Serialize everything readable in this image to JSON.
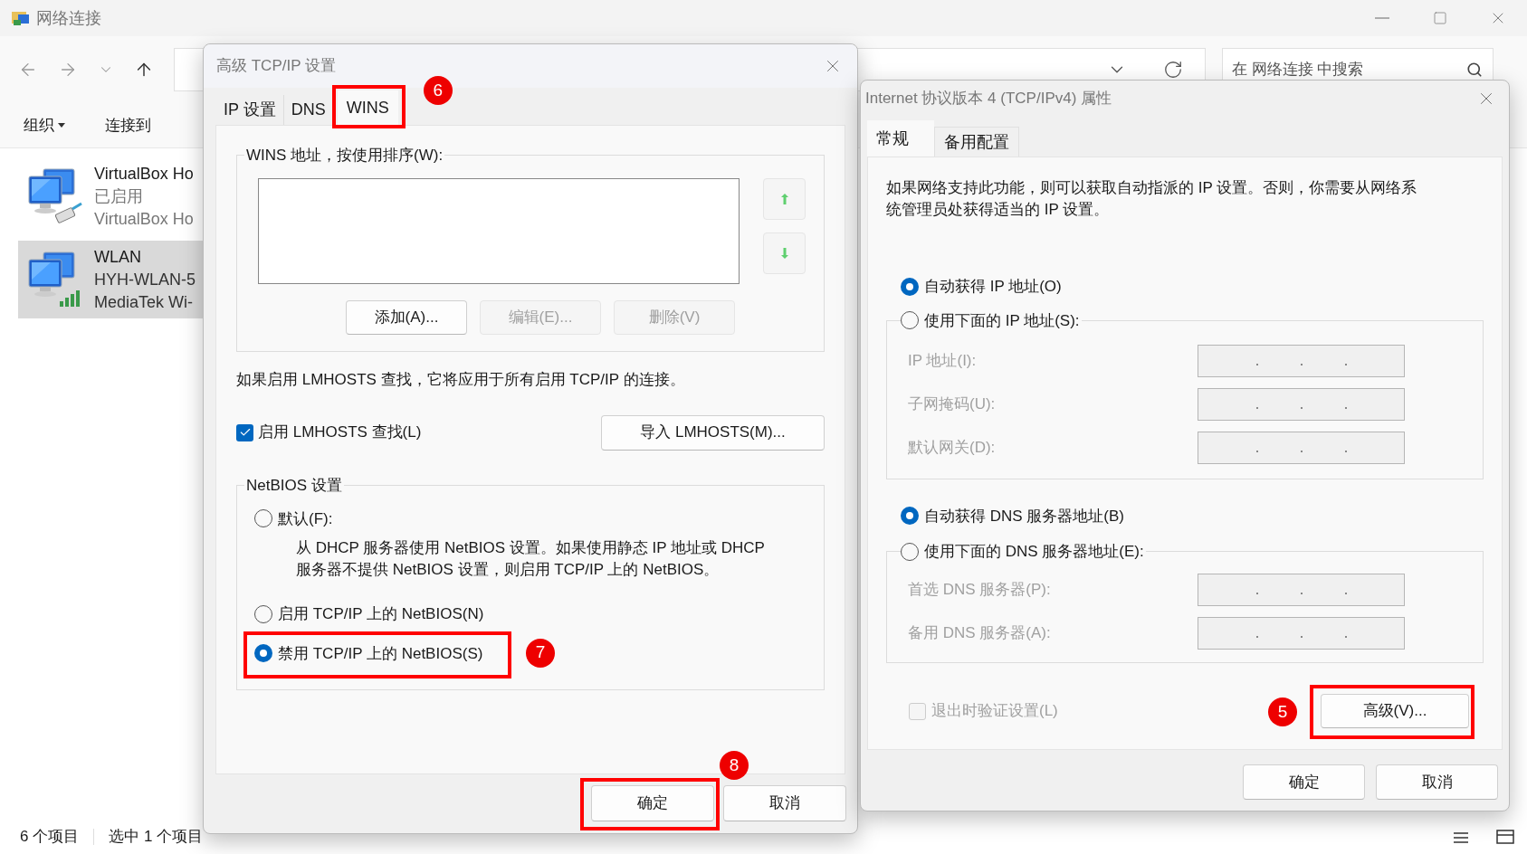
{
  "explorer": {
    "title": "网络连接",
    "search": {
      "placeholder": "在 网络连接 中搜索"
    },
    "toolbar": [
      {
        "label": "组织",
        "dropdown": true
      },
      {
        "label": "连接到",
        "dropdown": false
      }
    ],
    "items": [
      {
        "name": "VirtualBox Ho",
        "lines": [
          "已启用",
          "VirtualBox Ho"
        ],
        "kind": "ethernet",
        "selected": false
      },
      {
        "name": "WLAN",
        "lines": [
          "HYH-WLAN-5",
          "MediaTek Wi-"
        ],
        "kind": "wifi",
        "selected": true
      }
    ],
    "status_bar": [
      "6 个项目",
      "选中 1 个项目"
    ]
  },
  "advanced": {
    "title": "高级 TCP/IP 设置",
    "tabs": [
      {
        "label": "IP 设置",
        "selected": false
      },
      {
        "label": "DNS",
        "selected": false
      },
      {
        "label": "WINS",
        "selected": true,
        "callout": "6"
      }
    ],
    "wins_group": {
      "label": "WINS 地址，按使用排序(W):",
      "buttons": [
        {
          "label": "添加(A)...",
          "disabled": false
        },
        {
          "label": "编辑(E)...",
          "disabled": true
        },
        {
          "label": "删除(V)",
          "disabled": true
        }
      ]
    },
    "lmhosts_note": "如果启用 LMHOSTS 查找，它将应用于所有启用 TCP/IP 的连接。",
    "lmhosts_checkbox": {
      "label": "启用 LMHOSTS 查找(L)",
      "checked": true
    },
    "import_button": "导入 LMHOSTS(M)...",
    "netbios": {
      "label": "NetBIOS 设置",
      "options": [
        {
          "label": "默认(F):",
          "selected": false,
          "description_lines": [
            "从 DHCP 服务器使用 NetBIOS 设置。如果使用静态 IP 地址或 DHCP",
            "服务器不提供 NetBIOS 设置，则启用 TCP/IP 上的 NetBIOS。"
          ]
        },
        {
          "label": "启用 TCP/IP 上的 NetBIOS(N)",
          "selected": false
        },
        {
          "label": "禁用 TCP/IP 上的 NetBIOS(S)",
          "selected": true,
          "callout": "7"
        }
      ]
    },
    "buttons": [
      {
        "label": "确定",
        "callout": "8"
      },
      {
        "label": "取消"
      }
    ]
  },
  "ipv4": {
    "title": "Internet 协议版本 4 (TCP/IPv4) 属性",
    "tabs": [
      {
        "label": "常规",
        "selected": true
      },
      {
        "label": "备用配置",
        "selected": false
      }
    ],
    "description_lines": [
      "如果网络支持此功能，则可以获取自动指派的 IP 设置。否则，你需要从网络系",
      "统管理员处获得适当的 IP 设置。"
    ],
    "ip_options": [
      {
        "label": "自动获得 IP 地址(O)",
        "selected": true
      },
      {
        "label": "使用下面的 IP 地址(S):",
        "selected": false
      }
    ],
    "ip_fields": [
      {
        "label": "IP 地址(I):",
        "disabled": true
      },
      {
        "label": "子网掩码(U):",
        "disabled": true
      },
      {
        "label": "默认网关(D):",
        "disabled": true
      }
    ],
    "dns_options": [
      {
        "label": "自动获得 DNS 服务器地址(B)",
        "selected": true
      },
      {
        "label": "使用下面的 DNS 服务器地址(E):",
        "selected": false
      }
    ],
    "dns_fields": [
      {
        "label": "首选 DNS 服务器(P):",
        "disabled": true
      },
      {
        "label": "备用 DNS 服务器(A):",
        "disabled": true
      }
    ],
    "validate_checkbox": {
      "label": "退出时验证设置(L)",
      "checked": false,
      "disabled": true
    },
    "advanced_button": {
      "label": "高级(V)...",
      "callout": "5"
    },
    "buttons": [
      {
        "label": "确定"
      },
      {
        "label": "取消"
      }
    ]
  }
}
